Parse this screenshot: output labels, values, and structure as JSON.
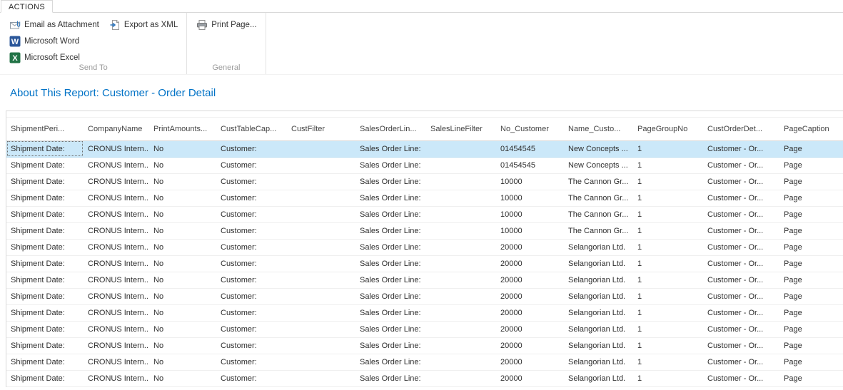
{
  "window": {
    "actions_tab": "ACTIONS"
  },
  "ribbon": {
    "groups": [
      {
        "label": "Send To",
        "items": [
          {
            "label": "Email as Attachment",
            "icon": "email-attachment-icon"
          },
          {
            "label": "Export as XML",
            "icon": "export-xml-icon"
          },
          {
            "label": "Microsoft Word",
            "icon": "word-icon",
            "icon_letter": "W"
          },
          {
            "label": "Microsoft Excel",
            "icon": "excel-icon",
            "icon_letter": "X"
          }
        ]
      },
      {
        "label": "General",
        "items": [
          {
            "label": "Print Page...",
            "icon": "print-icon"
          }
        ]
      }
    ]
  },
  "report": {
    "title": "About This Report: Customer - Order Detail"
  },
  "table": {
    "selected_row_index": 0,
    "columns": [
      {
        "key": "shipment-period",
        "label": "ShipmentPeri..."
      },
      {
        "key": "company-name",
        "label": "CompanyName"
      },
      {
        "key": "print-amounts",
        "label": "PrintAmounts..."
      },
      {
        "key": "cust-table-caption",
        "label": "CustTableCap..."
      },
      {
        "key": "cust-filter",
        "label": "CustFilter"
      },
      {
        "key": "sales-order-line",
        "label": "SalesOrderLin..."
      },
      {
        "key": "sales-line-filter",
        "label": "SalesLineFilter"
      },
      {
        "key": "no-customer",
        "label": "No_Customer"
      },
      {
        "key": "name-customer",
        "label": "Name_Custo..."
      },
      {
        "key": "page-group-no",
        "label": "PageGroupNo"
      },
      {
        "key": "cust-order-detail",
        "label": "CustOrderDet..."
      },
      {
        "key": "page-caption",
        "label": "PageCaption"
      }
    ],
    "rows": [
      [
        "Shipment Date:",
        "CRONUS Intern...",
        "No",
        "Customer:",
        "",
        "Sales Order Line:",
        "",
        "01454545",
        "New Concepts ...",
        "1",
        "Customer - Or...",
        "Page"
      ],
      [
        "Shipment Date:",
        "CRONUS Intern...",
        "No",
        "Customer:",
        "",
        "Sales Order Line:",
        "",
        "01454545",
        "New Concepts ...",
        "1",
        "Customer - Or...",
        "Page"
      ],
      [
        "Shipment Date:",
        "CRONUS Intern...",
        "No",
        "Customer:",
        "",
        "Sales Order Line:",
        "",
        "10000",
        "The Cannon Gr...",
        "1",
        "Customer - Or...",
        "Page"
      ],
      [
        "Shipment Date:",
        "CRONUS Intern...",
        "No",
        "Customer:",
        "",
        "Sales Order Line:",
        "",
        "10000",
        "The Cannon Gr...",
        "1",
        "Customer - Or...",
        "Page"
      ],
      [
        "Shipment Date:",
        "CRONUS Intern...",
        "No",
        "Customer:",
        "",
        "Sales Order Line:",
        "",
        "10000",
        "The Cannon Gr...",
        "1",
        "Customer - Or...",
        "Page"
      ],
      [
        "Shipment Date:",
        "CRONUS Intern...",
        "No",
        "Customer:",
        "",
        "Sales Order Line:",
        "",
        "10000",
        "The Cannon Gr...",
        "1",
        "Customer - Or...",
        "Page"
      ],
      [
        "Shipment Date:",
        "CRONUS Intern...",
        "No",
        "Customer:",
        "",
        "Sales Order Line:",
        "",
        "20000",
        "Selangorian Ltd.",
        "1",
        "Customer - Or...",
        "Page"
      ],
      [
        "Shipment Date:",
        "CRONUS Intern...",
        "No",
        "Customer:",
        "",
        "Sales Order Line:",
        "",
        "20000",
        "Selangorian Ltd.",
        "1",
        "Customer - Or...",
        "Page"
      ],
      [
        "Shipment Date:",
        "CRONUS Intern...",
        "No",
        "Customer:",
        "",
        "Sales Order Line:",
        "",
        "20000",
        "Selangorian Ltd.",
        "1",
        "Customer - Or...",
        "Page"
      ],
      [
        "Shipment Date:",
        "CRONUS Intern...",
        "No",
        "Customer:",
        "",
        "Sales Order Line:",
        "",
        "20000",
        "Selangorian Ltd.",
        "1",
        "Customer - Or...",
        "Page"
      ],
      [
        "Shipment Date:",
        "CRONUS Intern...",
        "No",
        "Customer:",
        "",
        "Sales Order Line:",
        "",
        "20000",
        "Selangorian Ltd.",
        "1",
        "Customer - Or...",
        "Page"
      ],
      [
        "Shipment Date:",
        "CRONUS Intern...",
        "No",
        "Customer:",
        "",
        "Sales Order Line:",
        "",
        "20000",
        "Selangorian Ltd.",
        "1",
        "Customer - Or...",
        "Page"
      ],
      [
        "Shipment Date:",
        "CRONUS Intern...",
        "No",
        "Customer:",
        "",
        "Sales Order Line:",
        "",
        "20000",
        "Selangorian Ltd.",
        "1",
        "Customer - Or...",
        "Page"
      ],
      [
        "Shipment Date:",
        "CRONUS Intern...",
        "No",
        "Customer:",
        "",
        "Sales Order Line:",
        "",
        "20000",
        "Selangorian Ltd.",
        "1",
        "Customer - Or...",
        "Page"
      ],
      [
        "Shipment Date:",
        "CRONUS Intern...",
        "No",
        "Customer:",
        "",
        "Sales Order Line:",
        "",
        "20000",
        "Selangorian Ltd.",
        "1",
        "Customer - Or...",
        "Page"
      ]
    ]
  },
  "colors": {
    "title_color": "#0072c6",
    "selected_row_bg": "#cbe8f9",
    "word_brand": "#2b579a",
    "excel_brand": "#217346",
    "export_arrow_blue": "#2f76bd"
  }
}
